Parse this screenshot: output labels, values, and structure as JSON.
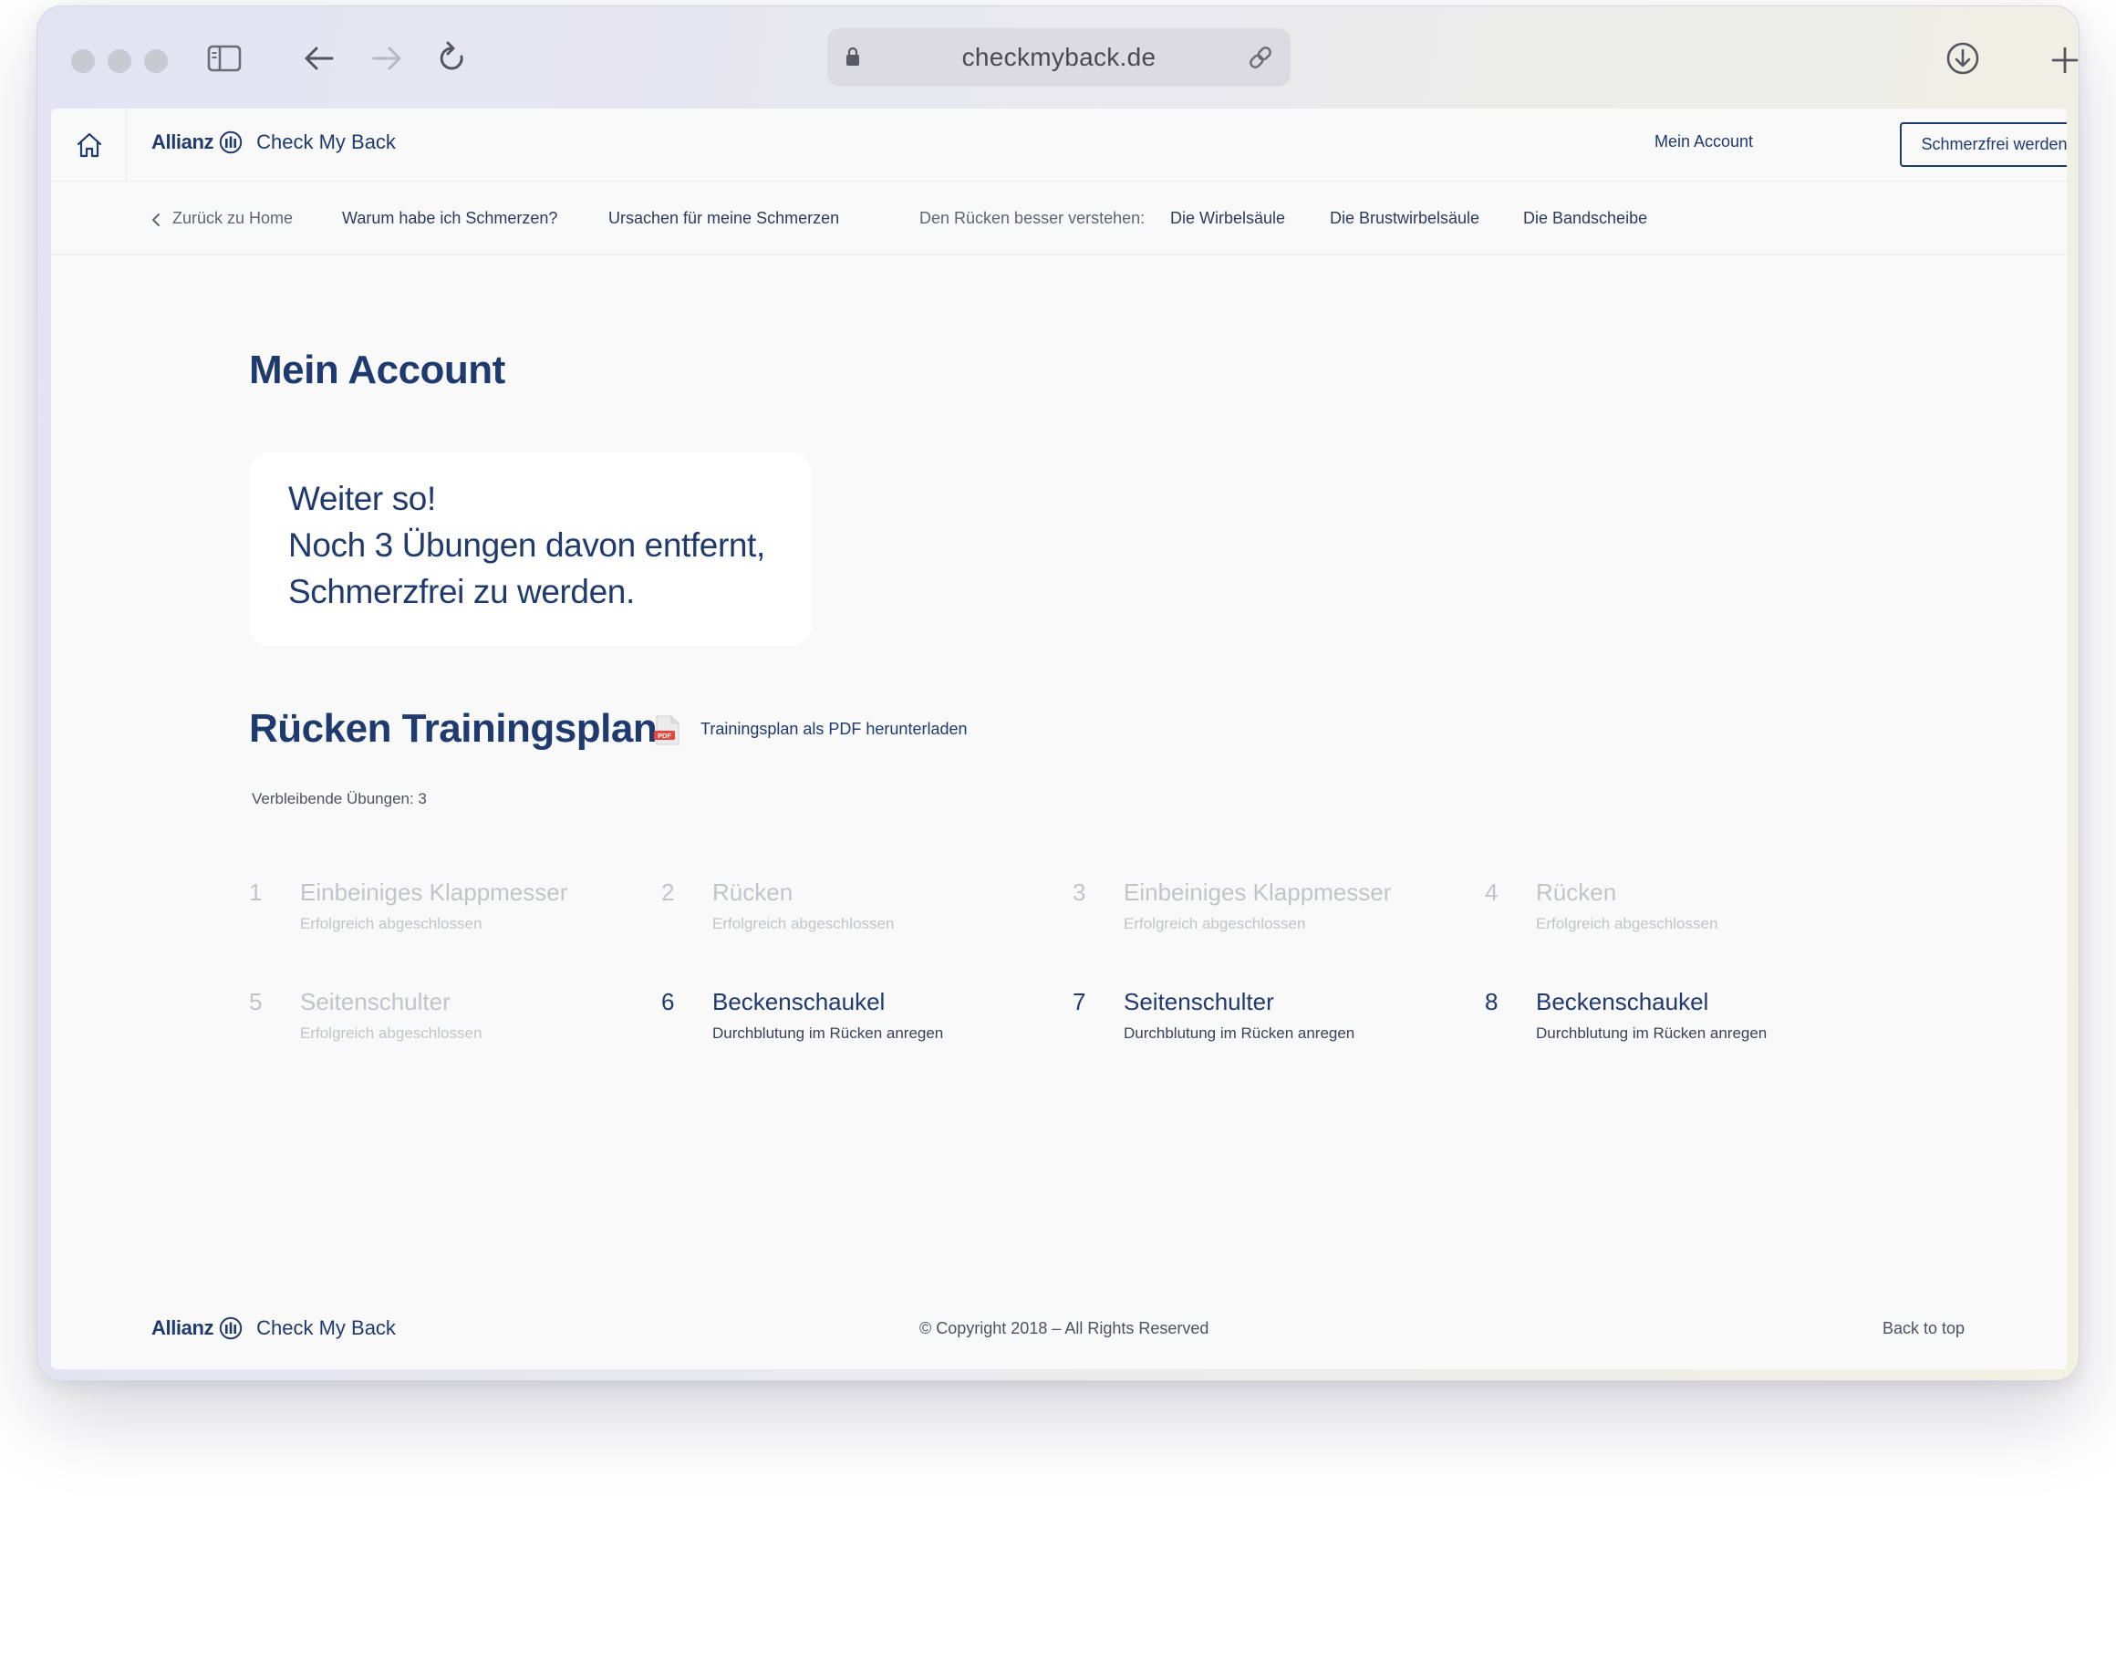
{
  "browser": {
    "url": "checkmyback.de"
  },
  "site": {
    "brand": "Allianz",
    "product": "Check My Back",
    "account_link": "Mein Account",
    "cta_button": "Schmerzfrei werden"
  },
  "subnav": {
    "back": "Zurück zu Home",
    "why": "Warum habe ich Schmerzen?",
    "causes": "Ursachen für meine Schmerzen",
    "understand_label": "Den Rücken besser verstehen:",
    "spine": "Die Wirbelsäule",
    "thoracic": "Die Brustwirbelsäule",
    "disc": "Die Bandscheibe"
  },
  "main": {
    "title": "Mein Account",
    "card": {
      "line1": "Weiter so!",
      "line2": "Noch 3 Übungen davon entfernt,",
      "line3": "Schmerzfrei zu werden."
    },
    "plan_title": "Rücken Trainingsplan",
    "pdf_icon_label": "PDF",
    "pdf_link": "Trainingsplan als PDF herunterladen",
    "remaining": "Verbleibende Übungen: 3",
    "exercises": [
      {
        "num": "1",
        "name": "Einbeiniges Klappmesser",
        "status": "Erfolgreich abgeschlossen",
        "done": true
      },
      {
        "num": "2",
        "name": "Rücken",
        "status": "Erfolgreich abgeschlossen",
        "done": true
      },
      {
        "num": "3",
        "name": "Einbeiniges Klappmesser",
        "status": "Erfolgreich abgeschlossen",
        "done": true
      },
      {
        "num": "4",
        "name": "Rücken",
        "status": "Erfolgreich abgeschlossen",
        "done": true
      },
      {
        "num": "5",
        "name": "Seitenschulter",
        "status": "Erfolgreich abgeschlossen",
        "done": true
      },
      {
        "num": "6",
        "name": "Beckenschaukel",
        "status": "Durchblutung im Rücken anregen",
        "done": false
      },
      {
        "num": "7",
        "name": "Seitenschulter",
        "status": "Durchblutung im Rücken anregen",
        "done": false
      },
      {
        "num": "8",
        "name": "Beckenschaukel",
        "status": "Durchblutung im Rücken anregen",
        "done": false
      }
    ]
  },
  "footer": {
    "copyright": "© Copyright 2018 – All Rights Reserved",
    "back_to_top": "Back to top"
  },
  "colors": {
    "brand_navy": "#1f3a6e",
    "completed_gray": "#c2c4cc",
    "page_bg": "#f9f9f9"
  },
  "icons": [
    "sidebar-toggle-icon",
    "back-arrow-icon",
    "forward-arrow-icon",
    "reload-icon",
    "lock-icon",
    "link-icon",
    "download-icon",
    "plus-icon",
    "home-icon",
    "chevron-left-icon",
    "pdf-file-icon"
  ]
}
